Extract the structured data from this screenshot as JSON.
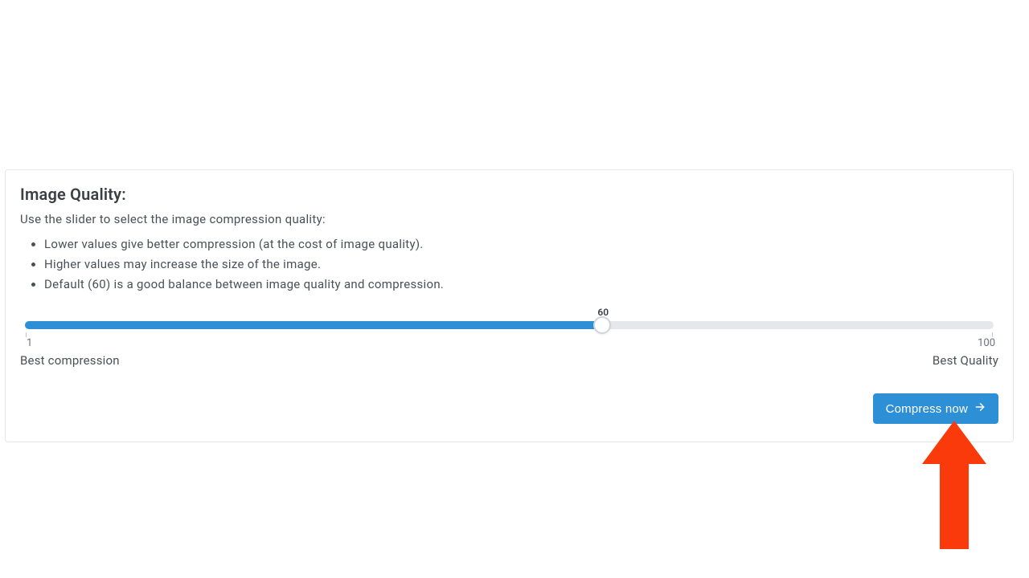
{
  "heading": "Image Quality:",
  "subtitle": "Use the slider to select the image compression quality:",
  "hints": [
    "Lower values give better compression (at the cost of image quality).",
    "Higher values may increase the size of the image.",
    "Default (60) is a good balance between image quality and compression."
  ],
  "slider": {
    "value": 60,
    "min": 1,
    "max": 100,
    "value_label": "60",
    "min_label": "1",
    "max_label": "100",
    "left_caption": "Best compression",
    "right_caption": "Best Quality"
  },
  "button": {
    "compress_label": "Compress now"
  },
  "colors": {
    "accent": "#2d8fd5",
    "arrow": "#fa3a0a"
  }
}
